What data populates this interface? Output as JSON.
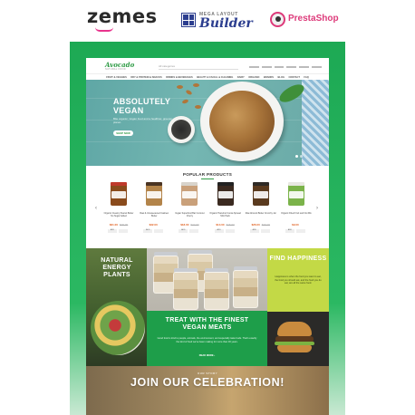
{
  "branding": {
    "zemes": "zemes",
    "mlb_top": "MEGA LAYOUT",
    "mlb_bottom": "Builder",
    "prestashop": "PrestaShop"
  },
  "site": {
    "logo": "Avocado",
    "logo_sub": "NATURAL FOOD",
    "search_placeholder": "All categories",
    "nav": [
      "FRUIT & VEGGIES",
      "DRY & PROTEIN & SNACKS",
      "DRINKS & BEVERAGES",
      "BEAUTY & FACIAL & CLEANING",
      "DAIRY",
      "ORGANIC",
      "BRANDS",
      "BLOG",
      "CONTACT",
      "FAQ"
    ],
    "hero": {
      "title": "ABSOLUTELY VEGAN",
      "subtitle": "Bite organic, Vegan food and a healthier, greener planet.",
      "button": "SHOP NOW"
    },
    "popular": {
      "title": "POPULAR PRODUCTS",
      "products": [
        {
          "name": "Organic Creamy Peanut Butter No Sugar Added",
          "price": "$21.00",
          "old": "$25.00",
          "lid": "#c0392b",
          "body": "#8a4b1c"
        },
        {
          "name": "Raw & Unsweetened Cashew Butter",
          "price": "$32.00",
          "old": "",
          "lid": "#4a3423",
          "body": "#b3844a"
        },
        {
          "name": "Vegan Superfood Bar Coconut Cherry",
          "price": "$18.00",
          "old": "$22.00",
          "lid": "#d8d4cc",
          "body": "#c9a07a"
        },
        {
          "name": "Organic Hazelnut Cocoa Spread Mini Pack",
          "price": "$14.00",
          "old": "$16.00",
          "lid": "#222222",
          "body": "#3b2a20"
        },
        {
          "name": "Raw Almond Butter Crunchy Jar",
          "price": "$26.00",
          "old": "$29.00",
          "lid": "#2e2a26",
          "body": "#5a3a1e"
        },
        {
          "name": "Organic Dried Fruit and Nut Mix",
          "price": "$9.00",
          "old": "",
          "lid": "#e8e8e2",
          "body": "#7bb34a"
        }
      ],
      "add_label": "ADD",
      "prev": "‹",
      "next": "›"
    },
    "promo_left": "NATURAL ENERGY PLANTS",
    "promo_right": {
      "title": "FIND HAPPINESS",
      "text": "Happiness is when the food you want to eat, the food you should eat, and the food you do eat, are all the same food."
    },
    "promo_center": {
      "title": "TREAT WITH THE FINEST VEGAN MEATS",
      "text": "Good food is kind to people, animals, the environment, and especially taste buds. That's exactly the kind of food we've been making for more than 30 years.",
      "link": "READ MORE ›"
    },
    "story": {
      "sub": "OUR STORY",
      "title": "JOIN OUR CELEBRATION!"
    }
  },
  "colors": {
    "frame_green": "#1da954",
    "brand_green": "#2e9b45",
    "lime": "#c3d946",
    "accent_pink": "#e8338c",
    "prestashop_pink": "#dd3a7a"
  }
}
